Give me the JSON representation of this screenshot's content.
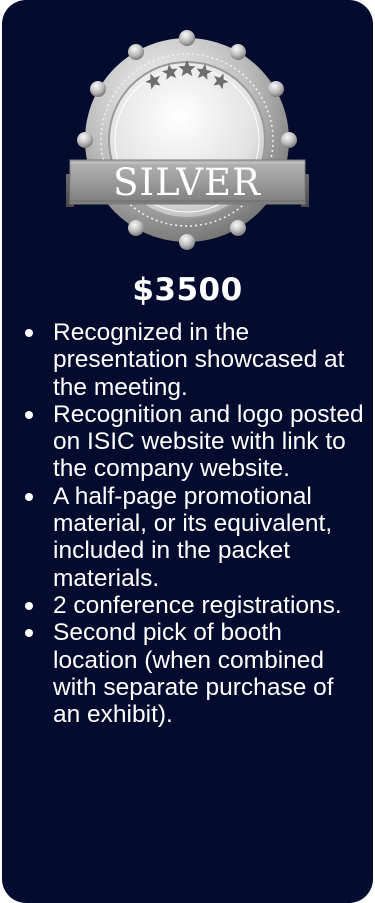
{
  "tier": {
    "name": "SILVER",
    "price": "$3500",
    "colors": {
      "background": "#030b2e",
      "text": "#ffffff",
      "silver_light": "#e6e6e6",
      "silver_dark": "#8c8c8c",
      "ribbon": "#9a9a9a"
    },
    "badge_icons": [
      "star-icon",
      "star-icon",
      "star-icon",
      "star-icon",
      "star-icon"
    ]
  },
  "benefits": [
    {
      "text": "Recognized in the presentation showcased at the meeting."
    },
    {
      "text": "Recognition and logo posted on ISIC website with link to the company website."
    },
    {
      "text": "A half-page promotional material, or its equivalent, included in the packet materials."
    },
    {
      "text": "2 conference registrations."
    },
    {
      "text": "Second pick of booth location  (when combined with separate purchase of an exhibit)."
    }
  ]
}
